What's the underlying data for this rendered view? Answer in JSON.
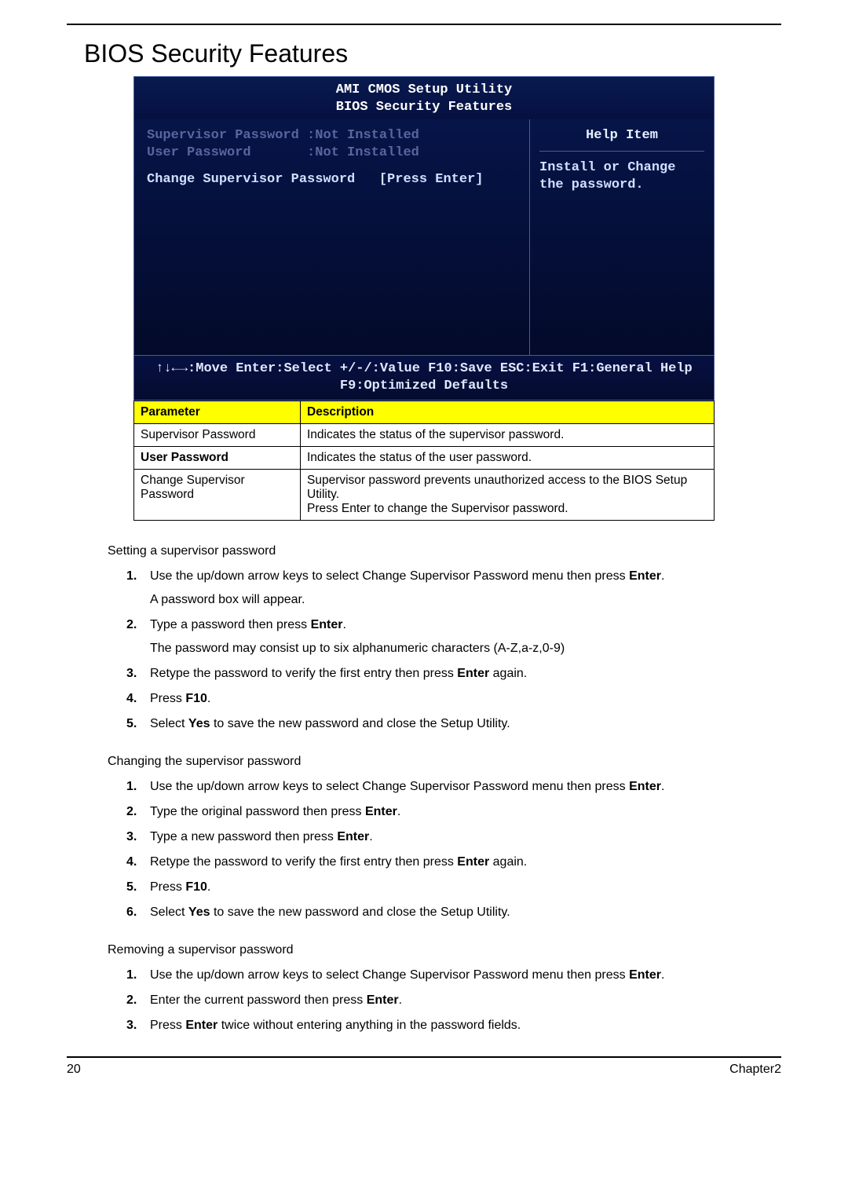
{
  "heading": "BIOS Security Features",
  "bios": {
    "title_line1": "AMI CMOS Setup Utility",
    "title_line2": "BIOS Security Features",
    "supervisor_label": "Supervisor Password :",
    "supervisor_value": "Not Installed",
    "user_label": "User Password       :",
    "user_value": "Not Installed",
    "change_label": "Change Supervisor Password",
    "change_action": "[Press Enter]",
    "help_title": "Help Item",
    "help_text": "Install or Change the password.",
    "footer_line1": "↑↓←→:Move  Enter:Select  +/-/:Value  F10:Save  ESC:Exit  F1:General Help",
    "footer_line2": "F9:Optimized Defaults"
  },
  "param_table": {
    "header_param": "Parameter",
    "header_desc": "Description",
    "rows": [
      {
        "param": "Supervisor Password",
        "param_bold": false,
        "desc": "Indicates the status of the supervisor password."
      },
      {
        "param": "User Password",
        "param_bold": true,
        "desc": "Indicates the status of the user password."
      },
      {
        "param": "Change Supervisor Password",
        "param_bold": false,
        "desc": "Supervisor password prevents unauthorized access to the BIOS Setup Utility.\nPress Enter to change the Supervisor password."
      }
    ]
  },
  "setting_intro": "Setting a supervisor password",
  "setting_steps": [
    {
      "html": "Use the up/down arrow keys to select Change Supervisor Password menu then press <b>Enter</b>.",
      "sub": "A password box will appear."
    },
    {
      "html": "Type a password then press <b>Enter</b>.",
      "sub": "The password may consist up to six alphanumeric characters (A-Z,a-z,0-9)"
    },
    {
      "html": "Retype the password to verify the first entry then press <b>Enter</b> again."
    },
    {
      "html": "Press <b>F10</b>."
    },
    {
      "html": "Select <b>Yes</b> to save the new password and close the Setup Utility."
    }
  ],
  "changing_intro": "Changing the supervisor password",
  "changing_steps": [
    {
      "html": "Use the up/down arrow keys to select Change Supervisor Password menu then press <b>Enter</b>."
    },
    {
      "html": "Type the original password then press <b>Enter</b>."
    },
    {
      "html": "Type a new password then press <b>Enter</b>."
    },
    {
      "html": "Retype the password to verify the first entry then press <b>Enter</b> again."
    },
    {
      "html": "Press <b>F10</b>."
    },
    {
      "html": "Select <b>Yes</b> to save the new password and close the Setup Utility."
    }
  ],
  "removing_intro": "Removing a supervisor password",
  "removing_steps": [
    {
      "html": "Use the up/down arrow keys to select Change Supervisor Password menu then press <b>Enter</b>."
    },
    {
      "html": "Enter the current password then press <b>Enter</b>."
    },
    {
      "html": "Press <b>Enter</b> twice without entering anything in the password fields."
    }
  ],
  "footer_left": "20",
  "footer_right": "Chapter2"
}
